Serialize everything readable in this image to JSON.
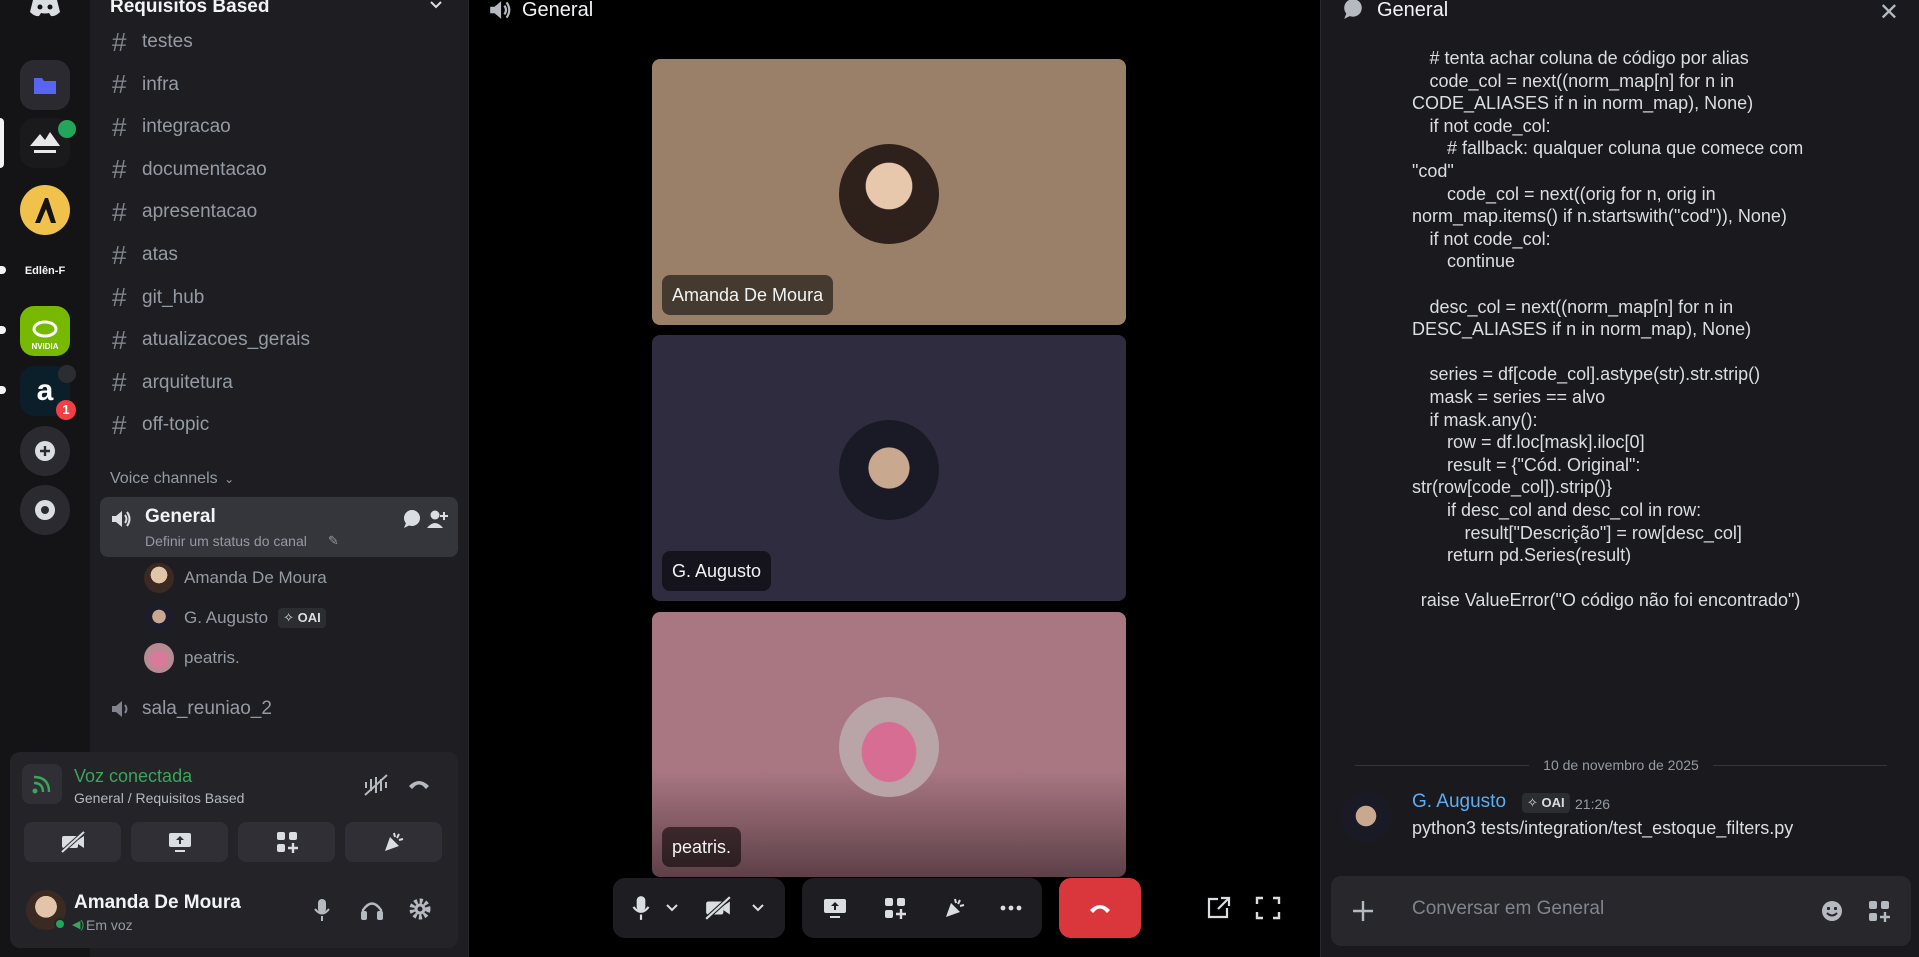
{
  "server": {
    "name": "Requisitos Based",
    "rail_labels": {
      "edlen": "Edlên-F",
      "nvidia": "NVIDIA",
      "notification_count": "1"
    }
  },
  "channels": [
    "testes",
    "infra",
    "integracao",
    "documentacao",
    "apresentacao",
    "atas",
    "git_hub",
    "atualizacoes_gerais",
    "arquitetura",
    "off-topic"
  ],
  "voice": {
    "header": "Voice channels",
    "general": {
      "name": "General",
      "status": "Definir um status do canal"
    },
    "users": [
      {
        "name": "Amanda De Moura"
      },
      {
        "name": "G. Augusto",
        "badge": "OAI"
      },
      {
        "name": "peatris."
      }
    ],
    "other_channel": "sala_reuniao_2"
  },
  "voice_connection": {
    "title": "Voz conectada",
    "subtitle": "General / Requisitos Based"
  },
  "current_user": {
    "name": "Amanda De Moura",
    "status": "Em voz"
  },
  "call": {
    "title": "General",
    "tiles": [
      {
        "name": "Amanda De Moura",
        "bg": "#9a8068"
      },
      {
        "name": "G. Augusto",
        "bg": "#2f2c3f"
      },
      {
        "name": "peatris.",
        "bg": "#a87782"
      }
    ]
  },
  "chat": {
    "title": "General",
    "code_lines": [
      {
        "text": "# tenta achar coluna de código por alias",
        "indent": 1
      },
      {
        "text": "code_col = next((norm_map[n] for n in",
        "indent": 1
      },
      {
        "text": "CODE_ALIASES if n in norm_map), None)",
        "indent": 0
      },
      {
        "text": "if not code_col:",
        "indent": 1
      },
      {
        "text": "# fallback: qualquer coluna que comece com",
        "indent": 2
      },
      {
        "text": "\"cod\"",
        "indent": 0
      },
      {
        "text": "code_col = next((orig for n, orig in",
        "indent": 2
      },
      {
        "text": "norm_map.items() if n.startswith(\"cod\")), None)",
        "indent": 0
      },
      {
        "text": "if not code_col:",
        "indent": 1
      },
      {
        "text": "continue",
        "indent": 2
      },
      {
        "text": "",
        "indent": 0
      },
      {
        "text": "desc_col = next((norm_map[n] for n in",
        "indent": 1
      },
      {
        "text": "DESC_ALIASES if n in norm_map), None)",
        "indent": 0
      },
      {
        "text": "",
        "indent": 0
      },
      {
        "text": "series = df[code_col].astype(str).str.strip()",
        "indent": 1
      },
      {
        "text": "mask = series == alvo",
        "indent": 1
      },
      {
        "text": "if mask.any():",
        "indent": 1
      },
      {
        "text": "row = df.loc[mask].iloc[0]",
        "indent": 2
      },
      {
        "text": "result = {\"Cód. Original\":",
        "indent": 2
      },
      {
        "text": "str(row[code_col]).strip()}",
        "indent": 0
      },
      {
        "text": "if desc_col and desc_col in row:",
        "indent": 2
      },
      {
        "text": "result[\"Descrição\"] = row[desc_col]",
        "indent": 3
      },
      {
        "text": "return pd.Series(result)",
        "indent": 2
      },
      {
        "text": "",
        "indent": 0
      },
      {
        "text": "raise ValueError(\"O código não foi encontrado\")",
        "indent": 0.5
      }
    ],
    "date_separator": "10 de novembro de 2025",
    "message": {
      "author": "G. Augusto",
      "badge": "OAI",
      "time": "21:26",
      "text": "python3 tests/integration/test_estoque_filters.py"
    },
    "input_placeholder": "Conversar em General"
  },
  "colors": {
    "accent_green": "#3ba55d",
    "hangup_red": "#da373c",
    "author_blue": "#5cadf2"
  }
}
